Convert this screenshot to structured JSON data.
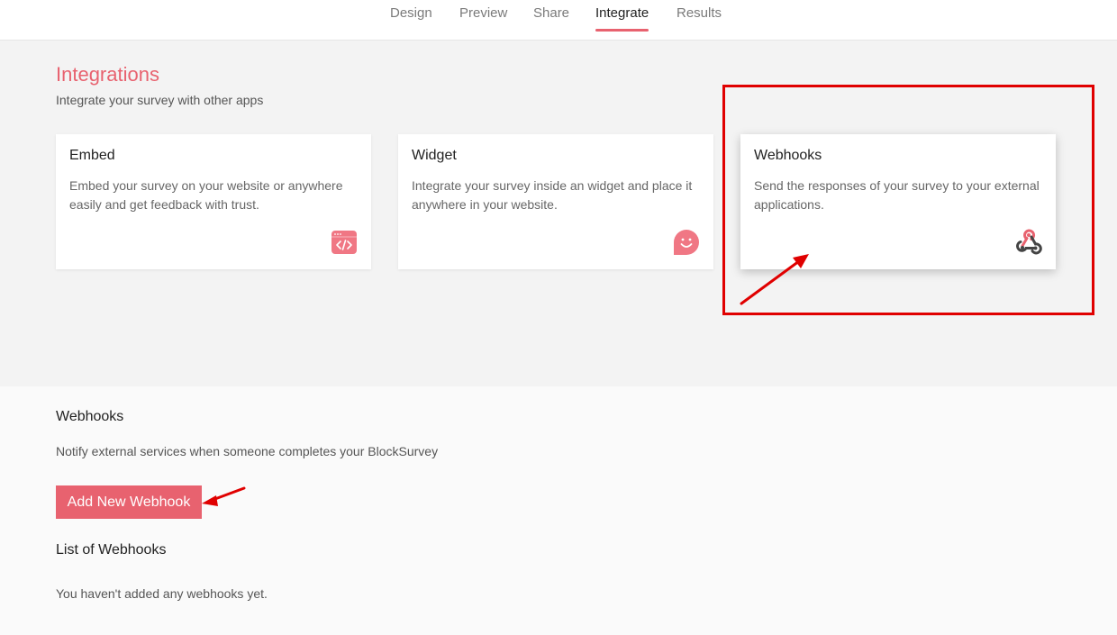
{
  "nav": {
    "tabs": [
      {
        "label": "Design"
      },
      {
        "label": "Preview"
      },
      {
        "label": "Share"
      },
      {
        "label": "Integrate"
      },
      {
        "label": "Results"
      }
    ],
    "active": "Integrate"
  },
  "integrations": {
    "title": "Integrations",
    "subtitle": "Integrate your survey with other apps",
    "cards": [
      {
        "title": "Embed",
        "desc": "Embed your survey on your website or anywhere easily and get feedback with trust.",
        "icon": "code-window-icon"
      },
      {
        "title": "Widget",
        "desc": "Integrate your survey inside an widget and place it anywhere in your website.",
        "icon": "smiley-chat-icon"
      },
      {
        "title": "Webhooks",
        "desc": "Send the responses of your survey to your external applications.",
        "icon": "webhook-icon"
      }
    ]
  },
  "webhooks": {
    "title": "Webhooks",
    "description": "Notify external services when someone completes your BlockSurvey",
    "add_button": "Add New Webhook",
    "list_title": "List of Webhooks",
    "empty_text": "You haven't added any webhooks yet."
  },
  "colors": {
    "accent": "#e8626f",
    "annotation": "#e00000"
  }
}
